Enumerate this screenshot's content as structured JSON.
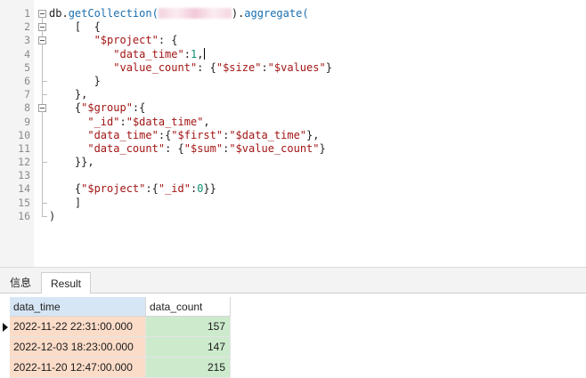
{
  "editor": {
    "lines": [
      {
        "num": "1",
        "fold": "box",
        "tokens": [
          {
            "t": "db.",
            "c": "c-plain"
          },
          {
            "t": "getCollection(",
            "c": "c-method"
          },
          {
            "blur": true
          },
          {
            "t": ").",
            "c": "c-plain"
          },
          {
            "t": "aggregate(",
            "c": "c-method"
          }
        ]
      },
      {
        "num": "2",
        "fold": "box",
        "tokens": [
          {
            "t": "    [  {",
            "c": "c-punc"
          }
        ]
      },
      {
        "num": "3",
        "fold": "box",
        "tokens": [
          {
            "t": "       ",
            "c": "c-plain"
          },
          {
            "t": "\"$project\"",
            "c": "c-key"
          },
          {
            "t": ": {",
            "c": "c-punc"
          }
        ]
      },
      {
        "num": "4",
        "fold": "line",
        "tokens": [
          {
            "t": "          ",
            "c": "c-plain"
          },
          {
            "t": "\"data_time\"",
            "c": "c-key"
          },
          {
            "t": ":",
            "c": "c-punc"
          },
          {
            "t": "1",
            "c": "c-num"
          },
          {
            "t": ",",
            "c": "c-punc"
          },
          {
            "caret": true
          }
        ]
      },
      {
        "num": "5",
        "fold": "line",
        "tokens": [
          {
            "t": "          ",
            "c": "c-plain"
          },
          {
            "t": "\"value_count\"",
            "c": "c-key"
          },
          {
            "t": ": {",
            "c": "c-punc"
          },
          {
            "t": "\"$size\"",
            "c": "c-key"
          },
          {
            "t": ":",
            "c": "c-punc"
          },
          {
            "t": "\"$values\"",
            "c": "c-key"
          },
          {
            "t": "}",
            "c": "c-punc"
          }
        ]
      },
      {
        "num": "6",
        "fold": "end",
        "tokens": [
          {
            "t": "       }",
            "c": "c-punc"
          }
        ]
      },
      {
        "num": "7",
        "fold": "end",
        "tokens": [
          {
            "t": "    },",
            "c": "c-punc"
          }
        ]
      },
      {
        "num": "8",
        "fold": "box",
        "tokens": [
          {
            "t": "    {",
            "c": "c-punc"
          },
          {
            "t": "\"$group\"",
            "c": "c-key"
          },
          {
            "t": ":{",
            "c": "c-punc"
          }
        ]
      },
      {
        "num": "9",
        "fold": "line",
        "tokens": [
          {
            "t": "      ",
            "c": "c-plain"
          },
          {
            "t": "\"_id\"",
            "c": "c-key"
          },
          {
            "t": ":",
            "c": "c-punc"
          },
          {
            "t": "\"$data_time\"",
            "c": "c-key"
          },
          {
            "t": ",",
            "c": "c-punc"
          }
        ]
      },
      {
        "num": "10",
        "fold": "line",
        "tokens": [
          {
            "t": "      ",
            "c": "c-plain"
          },
          {
            "t": "\"data_time\"",
            "c": "c-key"
          },
          {
            "t": ":{",
            "c": "c-punc"
          },
          {
            "t": "\"$first\"",
            "c": "c-key"
          },
          {
            "t": ":",
            "c": "c-punc"
          },
          {
            "t": "\"$data_time\"",
            "c": "c-key"
          },
          {
            "t": "},",
            "c": "c-punc"
          }
        ]
      },
      {
        "num": "11",
        "fold": "line",
        "tokens": [
          {
            "t": "      ",
            "c": "c-plain"
          },
          {
            "t": "\"data_count\"",
            "c": "c-key"
          },
          {
            "t": ": {",
            "c": "c-punc"
          },
          {
            "t": "\"$sum\"",
            "c": "c-key"
          },
          {
            "t": ":",
            "c": "c-punc"
          },
          {
            "t": "\"$value_count\"",
            "c": "c-key"
          },
          {
            "t": "}",
            "c": "c-punc"
          }
        ]
      },
      {
        "num": "12",
        "fold": "end",
        "tokens": [
          {
            "t": "    }},",
            "c": "c-punc"
          }
        ]
      },
      {
        "num": "13",
        "fold": "line",
        "tokens": []
      },
      {
        "num": "14",
        "fold": "line",
        "tokens": [
          {
            "t": "    {",
            "c": "c-punc"
          },
          {
            "t": "\"$project\"",
            "c": "c-key"
          },
          {
            "t": ":{",
            "c": "c-punc"
          },
          {
            "t": "\"_id\"",
            "c": "c-key"
          },
          {
            "t": ":",
            "c": "c-punc"
          },
          {
            "t": "0",
            "c": "c-num"
          },
          {
            "t": "}}",
            "c": "c-punc"
          }
        ]
      },
      {
        "num": "15",
        "fold": "end",
        "tokens": [
          {
            "t": "    ]",
            "c": "c-punc"
          }
        ]
      },
      {
        "num": "16",
        "fold": "end",
        "tokens": [
          {
            "t": ")",
            "c": "c-punc"
          }
        ]
      }
    ]
  },
  "panel": {
    "tabs": {
      "info": "信息",
      "result": "Result"
    },
    "columns": [
      "data_time",
      "data_count"
    ],
    "rows": [
      {
        "data_time": "2022-11-22 22:31:00.000",
        "data_count": "157",
        "current": true
      },
      {
        "data_time": "2022-12-03 18:23:00.000",
        "data_count": "147",
        "current": false
      },
      {
        "data_time": "2022-11-20 12:47:00.000",
        "data_count": "215",
        "current": false
      }
    ]
  },
  "colors": {
    "gutter": "#f4f4f4",
    "key_string": "#a31515",
    "method": "#1a6fb0",
    "number": "#0d8f6f",
    "time_cell": "#fbdcc8",
    "count_cell": "#cdeacd",
    "header_selected": "#d7e6f5"
  }
}
